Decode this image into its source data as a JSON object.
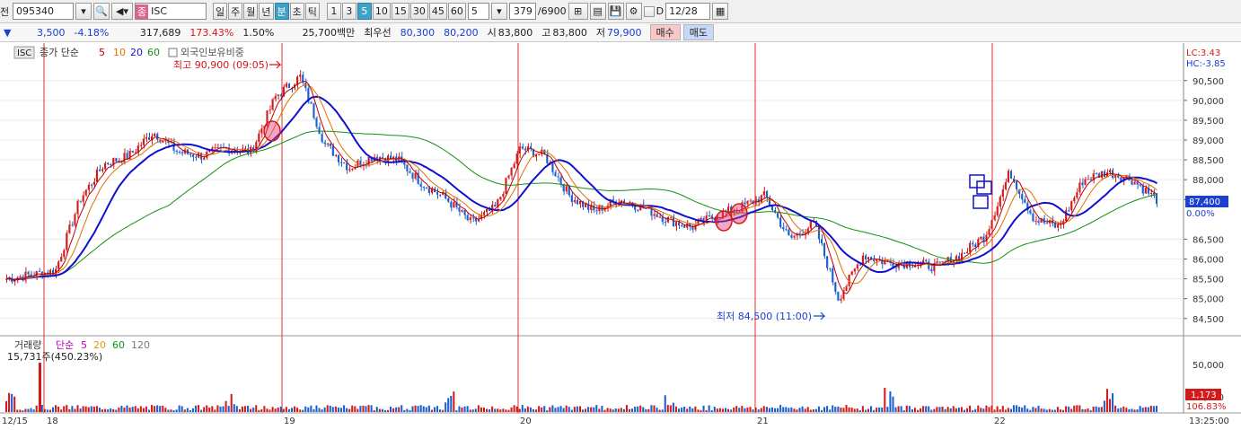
{
  "toolbar": {
    "prefix": "전",
    "code": "095340",
    "type_badge": "종",
    "name": "ISC",
    "periods": [
      "일",
      "주",
      "월",
      "년",
      "분",
      "초",
      "틱"
    ],
    "active_period": "분",
    "intervals": [
      "1",
      "3",
      "5",
      "10",
      "15",
      "30",
      "45",
      "60"
    ],
    "active_interval": "5",
    "interval_select": "5",
    "count": "379",
    "count_total": "/6900",
    "date": "12/28"
  },
  "quote": {
    "arrow": "▼",
    "change": "3,500",
    "change_pct": "-4.18%",
    "volume": "317,689",
    "vol_ratio": "173.43%",
    "turnover": "1.50%",
    "amount": "25,700백만",
    "best_label": "최우선",
    "best_ask": "80,300",
    "best_bid": "80,200",
    "open_label": "시",
    "open": "83,800",
    "high_label": "고",
    "high": "83,800",
    "low_label": "저",
    "low": "79,900",
    "buy_label": "매수",
    "sell_label": "매도"
  },
  "price_panel": {
    "tag": "ISC",
    "legend_label": "종가 단순",
    "ma_periods": [
      "5",
      "10",
      "20",
      "60"
    ],
    "extra": "외국인보유비중",
    "high_annot": "최고 90,900 (09:05)",
    "low_annot": "최저 84,500 (11:00)",
    "lc": "LC:3.43",
    "hc": "HC:-3.85",
    "last_price": "87,400",
    "last_pct": "0.00%"
  },
  "volume_panel": {
    "label": "거래량",
    "legend_label": "단순",
    "ma_periods": [
      "5",
      "20",
      "60",
      "120"
    ],
    "value": "15,731주(450.23%)",
    "last": "1,173",
    "last_pct": "106.83%"
  },
  "colors": {
    "up": "#d21a1a",
    "down": "#1a5fd1",
    "ma5": "#c00000",
    "ma10": "#e07000",
    "ma20": "#1010d0",
    "ma60": "#109010"
  },
  "chart_data": {
    "type": "candlestick",
    "price_axis": {
      "ticks": [
        "90,500",
        "90,000",
        "89,500",
        "89,000",
        "88,500",
        "88,000",
        "87,500",
        "86,500",
        "86,000",
        "85,500",
        "85,000",
        "84,500"
      ],
      "range": [
        84200,
        91400
      ]
    },
    "volume_axis": {
      "ticks": [
        "50,000",
        "10,000"
      ]
    },
    "date_labels": [
      "12/15",
      "18",
      "19",
      "20",
      "21",
      "22"
    ],
    "time_label": "13:25:00",
    "close_anchors": [
      85500,
      85600,
      85700,
      87500,
      88400,
      88600,
      89200,
      88700,
      88600,
      88800,
      88700,
      90100,
      90600,
      88900,
      88300,
      88600,
      88500,
      87900,
      87500,
      86900,
      87300,
      88800,
      88600,
      87600,
      87200,
      87500,
      87300,
      87000,
      86800,
      87100,
      87300,
      87600,
      86500,
      86900,
      85000,
      86100,
      85900,
      85900,
      85800,
      86100,
      86600,
      88200,
      87000,
      86800,
      88000,
      88200,
      88000,
      87500
    ],
    "high": 90900,
    "low": 84500
  }
}
